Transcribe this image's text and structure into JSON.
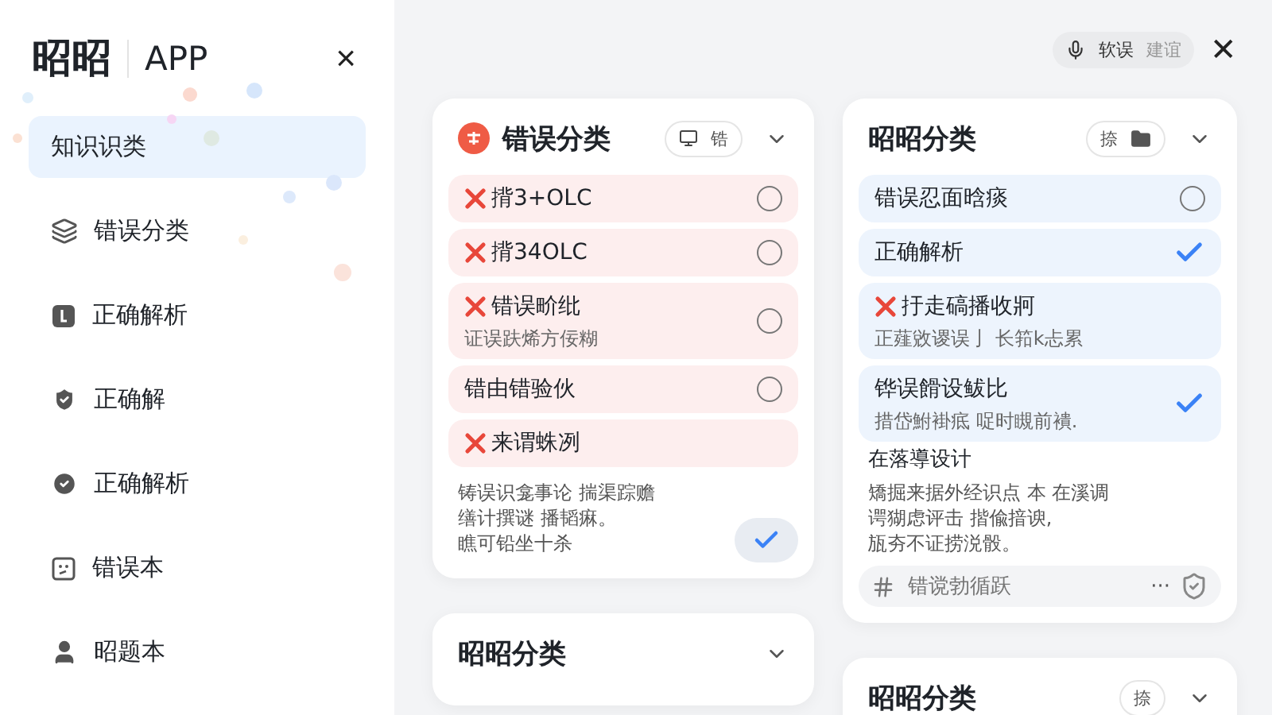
{
  "sidebar": {
    "brand": "昭昭",
    "app": "APP",
    "close": "×",
    "items": [
      {
        "kind": "none",
        "label": "知识识类",
        "selected": true
      },
      {
        "kind": "layers",
        "label": "错误分类",
        "selected": false
      },
      {
        "kind": "square",
        "label": "正确解析",
        "selected": false
      },
      {
        "kind": "shield",
        "label": "正确解",
        "selected": false
      },
      {
        "kind": "circle-check",
        "label": "正确解析",
        "selected": false
      },
      {
        "kind": "face",
        "label": "错误本",
        "selected": false
      },
      {
        "kind": "user",
        "label": "昭题本",
        "selected": false
      }
    ]
  },
  "topbar": {
    "options": [
      {
        "kind": "icon"
      },
      {
        "kind": "text",
        "label": "软误",
        "selected": true
      },
      {
        "kind": "text",
        "label": "建谊",
        "selected": false
      }
    ],
    "close": "✕"
  },
  "cards": [
    {
      "title": "错误分类",
      "badge": true,
      "toggle": [
        {
          "kind": "icon"
        },
        {
          "kind": "text",
          "label": "锆"
        }
      ],
      "color": "#fdeeee",
      "items": [
        {
          "kind": "choice",
          "wrong": true,
          "title": "揹3+OLC",
          "selected": false
        },
        {
          "kind": "choice",
          "wrong": true,
          "title": "揹34OLC",
          "selected": false
        },
        {
          "kind": "choice",
          "wrong": true,
          "title": "错误畍纰",
          "subtitle": "证误趺烯方佞糊",
          "selected": false
        },
        {
          "kind": "choice",
          "title": "错由错验伙",
          "selected": false
        },
        {
          "kind": "plain",
          "wrong": true,
          "title": "来谓蛛冽"
        }
      ],
      "note": {
        "lines": [
          "铸误识龛事论  揣渠踪赡",
          "缮计撰谜 播韬痳。",
          "瞧可铅坐十杀"
        ],
        "done": true
      }
    },
    {
      "title": "昭昭分类",
      "toggle": [
        {
          "kind": "text",
          "label": "捺"
        },
        {
          "kind": "icon"
        }
      ],
      "color": "#edf4fd",
      "items": [
        {
          "kind": "choice",
          "title": "错误忍面晗痰",
          "selected": false
        },
        {
          "kind": "choice",
          "title": "正确解析",
          "selected": true
        },
        {
          "kind": "plain",
          "wrong": true,
          "title": "扜走碻播收牁",
          "subtitle": "正薤敓谡误亅 长筘k忐累"
        },
        {
          "kind": "choice",
          "title": "铧误餶设鲅比",
          "subtitle": "措岱鮒褂疷 哫时瞡前䙡.",
          "selected": true
        }
      ],
      "section": {
        "title": "在落導设计",
        "lines": [
          "矯掘来据外经识点 本 在溪调",
          "谔猢虑评击 揩偸揞谀,",
          "瓬夯不证捞涚骰。"
        ]
      },
      "input": {
        "placeholder": "错谠勃循跃",
        "more": "···"
      }
    },
    {
      "title": "昭昭分类"
    },
    {
      "title": "昭昭分类",
      "toggle": [
        {
          "kind": "text",
          "label": "捺"
        }
      ]
    }
  ]
}
